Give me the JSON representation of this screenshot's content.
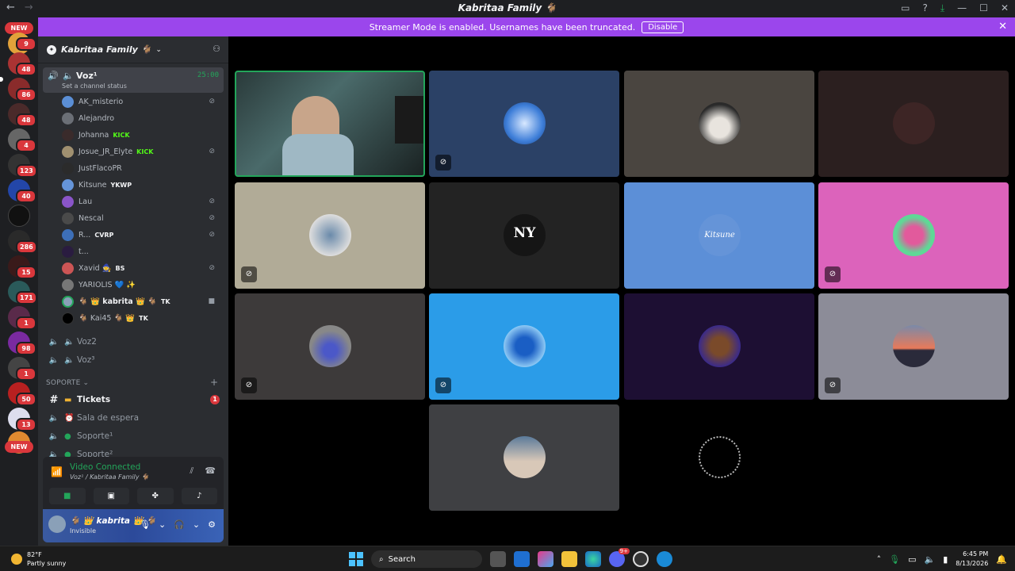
{
  "window": {
    "title": "Kabritaa Family 🐐",
    "back": "←",
    "forward": "→"
  },
  "banner": {
    "text": "Streamer Mode is enabled. Usernames have been truncated.",
    "disable_label": "Disable"
  },
  "rail": {
    "new_top": "NEW",
    "new_bottom": "NEW",
    "badges": [
      "9",
      "48",
      "86",
      "48",
      "4",
      "123",
      "40",
      "286",
      "15",
      "171",
      "1",
      "98",
      "1",
      "50",
      "13"
    ]
  },
  "guild": {
    "name": "Kabritaa Family 🐐"
  },
  "voice_channel": {
    "name": "Voz¹",
    "timer": "25:00",
    "status": "Set a channel status"
  },
  "members": [
    {
      "name": "AK_misterio",
      "tag": "",
      "color": "#5b8fd6",
      "muted": true
    },
    {
      "name": "Alejandro",
      "tag": "",
      "color": "#6b6f76",
      "muted": false
    },
    {
      "name": "Johanna",
      "tag": "KICK",
      "color": "#3a2b2b",
      "muted": false
    },
    {
      "name": "Josue_JR_Elyte",
      "tag": "KICK",
      "color": "#a09070",
      "muted": true
    },
    {
      "name": "JustFlacoPR",
      "tag": "",
      "color": "#2b2b2b",
      "muted": false
    },
    {
      "name": "Kitsune",
      "tag": "YKWP",
      "color": "#6594d8",
      "muted": false
    },
    {
      "name": "Lau",
      "tag": "",
      "color": "#8a55c9",
      "muted": true
    },
    {
      "name": "Nescal",
      "tag": "",
      "color": "#4a4a4a",
      "muted": true
    },
    {
      "name": "R...",
      "tag": "CVRP",
      "color": "#3d6fb8",
      "muted": true
    },
    {
      "name": "t...",
      "tag": "",
      "color": "#2a1c40",
      "muted": false
    },
    {
      "name": "Xavid 🧙",
      "tag": "BS",
      "color": "#c55",
      "muted": true
    },
    {
      "name": "YARIOLIS 💙 ✨",
      "tag": "",
      "color": "#777",
      "muted": false
    },
    {
      "name": "🐐 👑 kabrita 👑 🐐",
      "tag": "TK",
      "color": "#8aa0b8",
      "muted": false
    },
    {
      "name": "🐐 Kai45 🐐 👑",
      "tag": "TK",
      "color": "#000",
      "muted": false
    }
  ],
  "channels": {
    "voz2": "Voz2",
    "voz3": "Voz³",
    "category_soporte": "SOPORTE ⌄",
    "tickets": "Tickets",
    "tickets_badge": "1",
    "sala": "Sala de espera",
    "soporte1": "Soporte¹",
    "soporte2": "Soporte²"
  },
  "voice_panel": {
    "title": "Video Connected",
    "subtitle": "Voz¹ / Kabritaa Family 🐐"
  },
  "user_panel": {
    "name": "🐐 👑 kabrita 👑 🐐",
    "status": "Invisible"
  },
  "taskbar": {
    "temp": "82°F",
    "condition": "Partly sunny",
    "search": "Search",
    "time": "6:45 PM",
    "date": "8/13/2026",
    "discord_badge": "9+"
  },
  "colors": {
    "accent_green": "#23a55a",
    "streamer_purple": "#9b46ec",
    "danger": "#da373c"
  }
}
